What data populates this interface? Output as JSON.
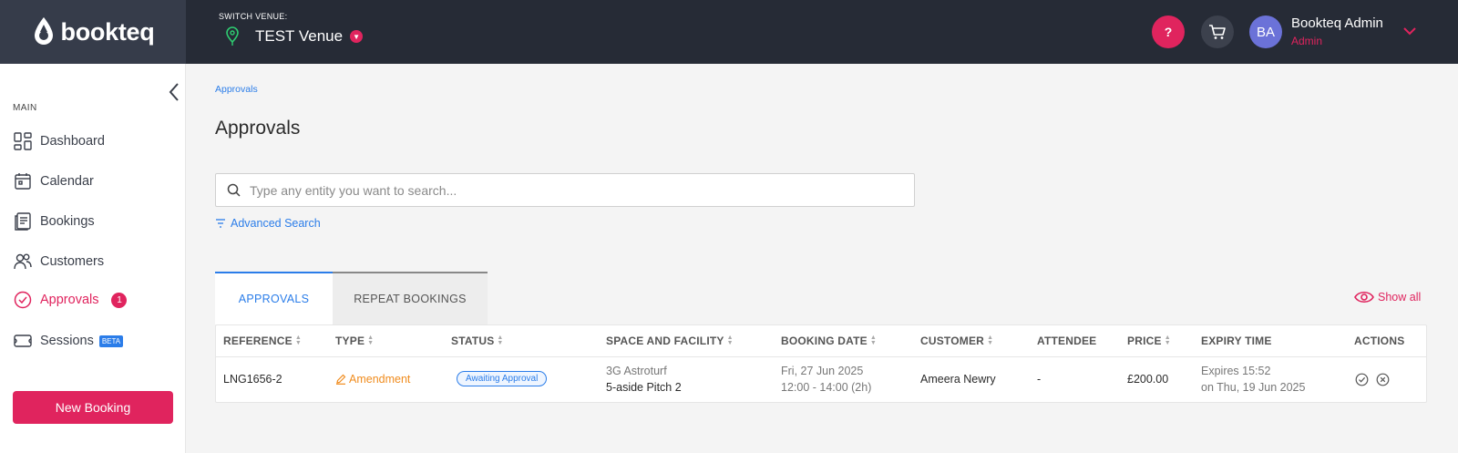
{
  "brand": {
    "name": "bookteq"
  },
  "venue": {
    "switch_label": "SWITCH VENUE:",
    "name": "TEST Venue"
  },
  "header": {
    "help_label": "?",
    "user_initials": "BA",
    "user_name": "Bookteq Admin",
    "user_role": "Admin"
  },
  "sidebar": {
    "section_label": "MAIN",
    "items": [
      {
        "label": "Dashboard",
        "icon": "dashboard-icon"
      },
      {
        "label": "Calendar",
        "icon": "calendar-icon"
      },
      {
        "label": "Bookings",
        "icon": "bookings-icon"
      },
      {
        "label": "Customers",
        "icon": "customers-icon"
      },
      {
        "label": "Approvals",
        "icon": "approvals-icon",
        "badge": "1",
        "active": true
      },
      {
        "label": "Sessions",
        "icon": "sessions-icon",
        "badge": "BETA"
      }
    ],
    "new_booking_label": "New Booking"
  },
  "main": {
    "breadcrumb": "Approvals",
    "title": "Approvals",
    "search_placeholder": "Type any entity you want to search...",
    "advanced_search_label": "Advanced Search",
    "tabs": [
      {
        "label": "APPROVALS",
        "active": true
      },
      {
        "label": "REPEAT BOOKINGS",
        "active": false
      }
    ],
    "show_all_label": "Show all"
  },
  "table": {
    "columns": [
      "REFERENCE",
      "TYPE",
      "STATUS",
      "SPACE AND FACILITY",
      "BOOKING DATE",
      "CUSTOMER",
      "ATTENDEE",
      "PRICE",
      "EXPIRY TIME",
      "ACTIONS"
    ],
    "rows": [
      {
        "reference": "LNG1656-2",
        "type": "Amendment",
        "status": "Awaiting Approval",
        "space": "3G Astroturf",
        "facility": "5-aside Pitch 2",
        "booking_date": "Fri, 27 Jun 2025",
        "booking_time": "12:00 - 14:00 (2h)",
        "customer": "Ameera Newry",
        "attendee": "-",
        "price": "£200.00",
        "expiry_line1": "Expires 15:52",
        "expiry_line2": "on Thu, 19 Jun 2025"
      }
    ]
  },
  "colors": {
    "accent": "#e0245e",
    "link": "#2b7de9",
    "topbar": "#262b36",
    "amendment": "#f08c1e"
  }
}
